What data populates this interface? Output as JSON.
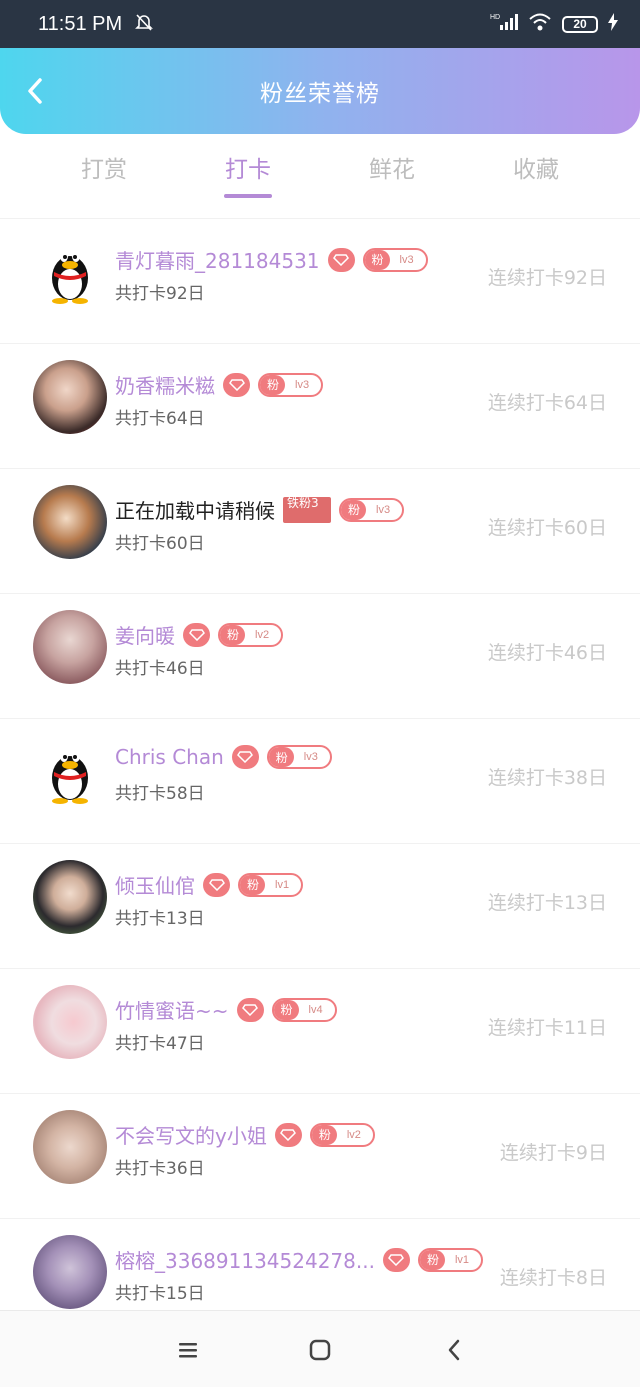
{
  "status": {
    "time": "11:51 PM",
    "network": "HD",
    "battery": "20"
  },
  "header": {
    "title": "粉丝荣誉榜"
  },
  "tabs": [
    {
      "label": "打赏",
      "active": false
    },
    {
      "label": "打卡",
      "active": true
    },
    {
      "label": "鲜花",
      "active": false
    },
    {
      "label": "收藏",
      "active": false
    }
  ],
  "fan_badge_label": "粉",
  "rows": [
    {
      "name": "青灯暮雨_281184531",
      "level": "lv3",
      "total": "共打卡92日",
      "streak": "连续打卡92日",
      "avatar": "qq-penguin-icon"
    },
    {
      "name": "奶香糯米糍",
      "level": "lv3",
      "total": "共打卡64日",
      "streak": "连续打卡64日",
      "avatar": "photo"
    },
    {
      "name": "正在加载中请稍候",
      "tie_badge": "铁粉3",
      "level": "lv3",
      "total": "共打卡60日",
      "streak": "连续打卡60日",
      "avatar": "photo"
    },
    {
      "name": "姜向暖",
      "level": "lv2",
      "total": "共打卡46日",
      "streak": "连续打卡46日",
      "avatar": "photo"
    },
    {
      "name": "Chris Chan",
      "level": "lv3",
      "total": "共打卡58日",
      "streak": "连续打卡38日",
      "avatar": "qq-penguin-icon"
    },
    {
      "name": "倾玉仙倌",
      "level": "lv1",
      "total": "共打卡13日",
      "streak": "连续打卡13日",
      "avatar": "photo"
    },
    {
      "name": "竹情蜜语~~",
      "level": "lv4",
      "total": "共打卡47日",
      "streak": "连续打卡11日",
      "avatar": "photo"
    },
    {
      "name": "不会写文的y小姐",
      "level": "lv2",
      "total": "共打卡36日",
      "streak": "连续打卡9日",
      "avatar": "photo"
    },
    {
      "name": "榕榕_336891134524278...",
      "level": "lv1",
      "total": "共打卡15日",
      "streak": "连续打卡8日",
      "avatar": "photo"
    }
  ],
  "colors": {
    "accent": "#b48ad6",
    "badge": "#f07b7f",
    "header_start": "#4ed6ee",
    "header_end": "#b896ea"
  }
}
